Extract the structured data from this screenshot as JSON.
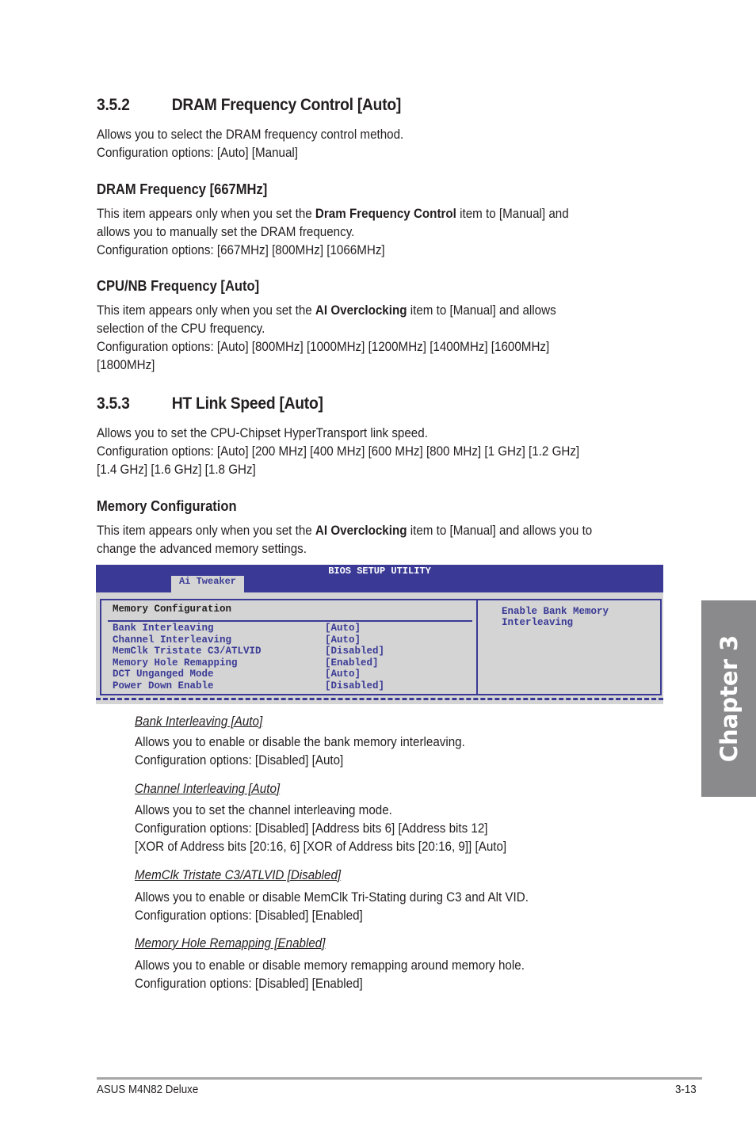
{
  "sections": {
    "s352": {
      "number": "3.5.2",
      "title": "DRAM Frequency Control [Auto]",
      "lines": [
        "Allows you to select the DRAM frequency control method.",
        "Configuration options: [Auto] [Manual]"
      ]
    },
    "dram_freq": {
      "title": "DRAM Frequency [667MHz]",
      "line1_pre": "This item appears only when you set the ",
      "line1_bold": "Dram Frequency Control",
      "line1_post": " item to [Manual] and",
      "line2": "allows you to manually set the DRAM frequency.",
      "line3": "Configuration options: [667MHz] [800MHz] [1066MHz]"
    },
    "cpunb": {
      "title": "CPU/NB Frequency [Auto]",
      "line1_pre": "This item appears only when you set the ",
      "line1_bold": "AI Overclocking",
      "line1_post": " item to [Manual] and allows",
      "line2": "selection of the CPU frequency.",
      "line3": "Configuration options: [Auto] [800MHz] [1000MHz] [1200MHz] [1400MHz] [1600MHz]",
      "line4": "[1800MHz]"
    },
    "s353": {
      "number": "3.5.3",
      "title": "HT Link Speed [Auto]",
      "lines": [
        "Allows you to set the CPU-Chipset HyperTransport link speed.",
        "Configuration options: [Auto] [200 MHz] [400 MHz] [600 MHz] [800 MHz] [1 GHz] [1.2 GHz]",
        "[1.4 GHz] [1.6 GHz] [1.8 GHz]"
      ]
    },
    "memcfg": {
      "title": "Memory Configuration",
      "line1_pre": "This item appears only when you set the ",
      "line1_bold": "AI Overclocking",
      "line1_post": " item to [Manual] and allows you to",
      "line2": "change the advanced memory settings."
    }
  },
  "bios": {
    "title": "BIOS SETUP UTILITY",
    "tab": "Ai Tweaker",
    "panel_title": "Memory Configuration",
    "items": [
      {
        "label": "Bank Interleaving",
        "value": "[Auto]"
      },
      {
        "label": "Channel Interleaving",
        "value": "[Auto]"
      },
      {
        "label": "MemClk Tristate C3/ATLVID",
        "value": "[Disabled]"
      },
      {
        "label": "Memory Hole Remapping",
        "value": "[Enabled]"
      },
      {
        "label": "DCT Unganged Mode",
        "value": "[Auto]"
      },
      {
        "label": "Power Down Enable",
        "value": "[Disabled]"
      }
    ],
    "help": [
      "Enable Bank Memory",
      "Interleaving"
    ]
  },
  "subitems": [
    {
      "title": "Bank Interleaving [Auto]",
      "lines": [
        "Allows you to enable or disable the bank memory interleaving.",
        "Configuration options: [Disabled] [Auto]"
      ]
    },
    {
      "title": "Channel Interleaving [Auto]",
      "lines": [
        "Allows you to set the channel interleaving mode.",
        "Configuration options: [Disabled] [Address bits 6] [Address bits 12]",
        "[XOR of Address bits [20:16, 6] [XOR of Address bits [20:16, 9]] [Auto]"
      ]
    },
    {
      "title": "MemClk Tristate C3/ATLVID [Disabled]",
      "lines": [
        "Allows you to enable or disable MemClk Tri-Stating during C3 and Alt VID.",
        "Configuration options: [Disabled] [Enabled]"
      ]
    },
    {
      "title": "Memory Hole Remapping [Enabled]",
      "lines": [
        "Allows you to enable or disable memory remapping around memory hole.",
        "Configuration options: [Disabled] [Enabled]"
      ]
    }
  ],
  "chapter_tab": "Chapter 3",
  "footer": {
    "left": "ASUS M4N82 Deluxe",
    "right": "3-13"
  }
}
